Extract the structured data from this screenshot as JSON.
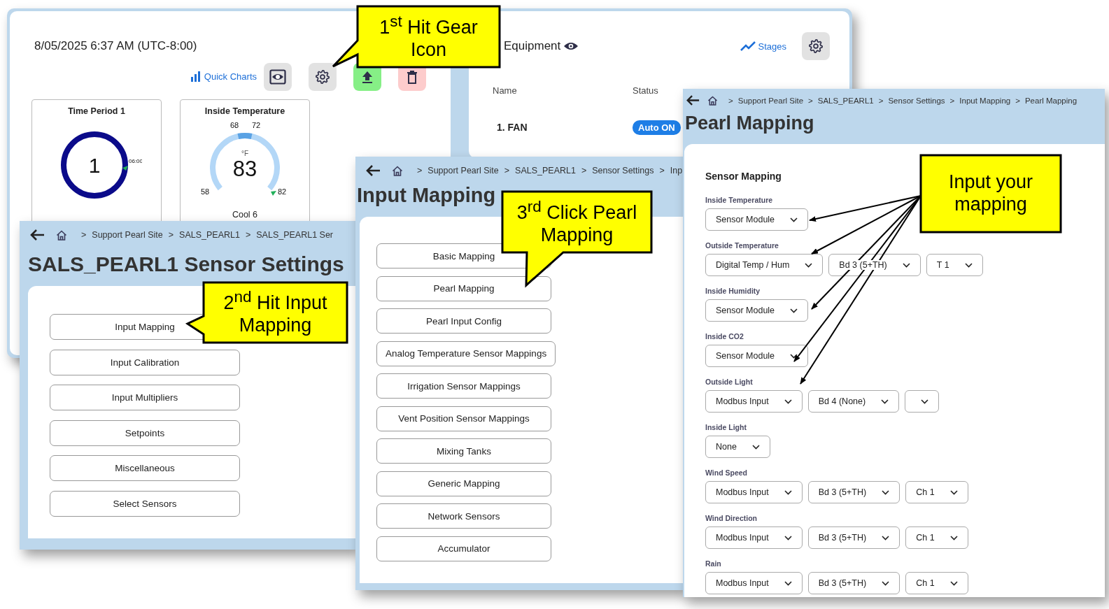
{
  "dashboard": {
    "datetime": "8/05/2025 6:37 AM (UTC-8:00)",
    "quick_charts": "Quick Charts",
    "toolbar": [
      {
        "kind": "view"
      },
      {
        "kind": "settings"
      },
      {
        "kind": "upload"
      },
      {
        "kind": "delete"
      }
    ],
    "cards": [
      {
        "kind": "ring",
        "title": "Time Period 1",
        "value": "1",
        "marker": "06:00"
      },
      {
        "kind": "gauge",
        "title": "Inside Temperature",
        "unit": "°F",
        "value": "83",
        "low": "58",
        "high": "82",
        "range_low": "68",
        "range_high": "72",
        "footer": "Cool 6"
      }
    ]
  },
  "equipment": {
    "title": "Equipment",
    "stages": "Stages",
    "columns": [
      "Name",
      "Status"
    ],
    "rows": [
      {
        "name": "1. FAN",
        "status": "Auto ON"
      }
    ]
  },
  "sensor_settings": {
    "breadcrumb": [
      {
        "sep": ">",
        "label": "Support Pearl Site"
      },
      {
        "sep": ">",
        "label": "SALS_PEARL1"
      },
      {
        "sep": ">",
        "label": "SALS_PEARL1 Ser"
      }
    ],
    "title": "SALS_PEARL1 Sensor Settings",
    "buttons": [
      "Input Mapping",
      "Input Calibration",
      "Input Multipliers",
      "Setpoints",
      "Miscellaneous",
      "Select Sensors"
    ]
  },
  "input_mapping": {
    "breadcrumb": [
      {
        "sep": ">",
        "label": "Support Pearl Site"
      },
      {
        "sep": ">",
        "label": "SALS_PEARL1"
      },
      {
        "sep": ">",
        "label": "Sensor Settings"
      },
      {
        "sep": ">",
        "label": "Inp"
      }
    ],
    "title": "Input Mapping",
    "buttons": [
      "Basic Mapping",
      "Pearl Mapping",
      "Pearl Input Config",
      "Analog Temperature Sensor Mappings",
      "Irrigation Sensor Mappings",
      "Vent Position Sensor Mappings",
      "Mixing Tanks",
      "Generic Mapping",
      "Network Sensors",
      "Accumulator"
    ]
  },
  "pearl_mapping": {
    "breadcrumb": [
      {
        "sep": ">",
        "label": "Support Pearl Site"
      },
      {
        "sep": ">",
        "label": "SALS_PEARL1"
      },
      {
        "sep": ">",
        "label": "Sensor Settings"
      },
      {
        "sep": ">",
        "label": "Input Mapping"
      },
      {
        "sep": ">",
        "label": "Pearl Mapping"
      }
    ],
    "title": "Pearl Mapping",
    "section": "Sensor Mapping",
    "fields": [
      {
        "label": "Inside Temperature",
        "selects": [
          {
            "value": "Sensor Module"
          }
        ]
      },
      {
        "label": "Outside Temperature",
        "selects": [
          {
            "value": "Digital Temp / Hum"
          },
          {
            "value": "Bd 3 (5+TH)"
          },
          {
            "value": "T 1"
          }
        ]
      },
      {
        "label": "Inside Humidity",
        "selects": [
          {
            "value": "Sensor Module"
          }
        ]
      },
      {
        "label": "Inside CO2",
        "selects": [
          {
            "value": "Sensor Module"
          }
        ]
      },
      {
        "label": "Outside Light",
        "selects": [
          {
            "value": "Modbus Input"
          },
          {
            "value": "Bd 4 (None)"
          },
          {
            "kind": "empty"
          }
        ]
      },
      {
        "label": "Inside Light",
        "selects": [
          {
            "value": "None"
          }
        ]
      },
      {
        "label": "Wind Speed",
        "selects": [
          {
            "value": "Modbus Input"
          },
          {
            "value": "Bd 3 (5+TH)"
          },
          {
            "value": "Ch 1"
          }
        ]
      },
      {
        "label": "Wind Direction",
        "selects": [
          {
            "value": "Modbus Input"
          },
          {
            "value": "Bd 3 (5+TH)"
          },
          {
            "value": "Ch 1"
          }
        ]
      },
      {
        "label": "Rain",
        "selects": [
          {
            "value": "Modbus Input"
          },
          {
            "value": "Bd 3 (5+TH)"
          },
          {
            "value": "Ch 1"
          }
        ]
      }
    ]
  },
  "callouts": [
    {
      "text": "1$^{st}$ Hit Gear Icon"
    },
    {
      "text": "2$^{nd}$ Hit Input Mapping"
    },
    {
      "text": "3$^{rd}$ Click Pearl Mapping"
    },
    {
      "text": "Input your mapping"
    }
  ]
}
